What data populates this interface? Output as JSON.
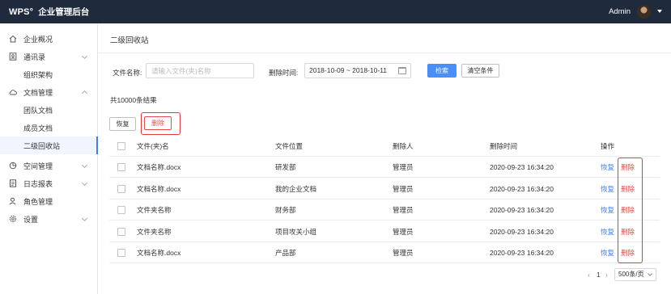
{
  "header": {
    "logo": "WPS°",
    "title": "企业管理后台",
    "user": "Admin"
  },
  "sidebar": {
    "items": [
      {
        "label": "企业概况",
        "icon": "home-icon"
      },
      {
        "label": "通讯录",
        "icon": "contacts-icon",
        "expandable": true
      },
      {
        "label": "组织架构",
        "sub": true
      },
      {
        "label": "文档管理",
        "icon": "cloud-icon",
        "expandable": true
      },
      {
        "label": "团队文档",
        "sub": true
      },
      {
        "label": "成员文档",
        "sub": true
      },
      {
        "label": "二级回收站",
        "sub": true,
        "active": true
      },
      {
        "label": "空间管理",
        "icon": "pie-chart-icon",
        "expandable": true
      },
      {
        "label": "日志报表",
        "icon": "report-icon",
        "expandable": true
      },
      {
        "label": "角色管理",
        "icon": "user-role-icon"
      },
      {
        "label": "设置",
        "icon": "gear-icon",
        "expandable": true
      }
    ]
  },
  "main": {
    "title": "二级回收站",
    "filter": {
      "name_label": "文件名称:",
      "name_placeholder": "请输入文件(夹)名称",
      "time_label": "删除时间:",
      "date_range": "2018-10-09 ~ 2018-10-11",
      "search_label": "检索",
      "clear_label": "清空条件"
    },
    "result_count": "共10000条结果",
    "actions": {
      "restore": "恢复",
      "delete": "删除"
    },
    "table": {
      "headers": [
        "文件(夹)名",
        "文件位置",
        "删除人",
        "删除时间",
        "操作"
      ],
      "rows": [
        {
          "name": "文档名称.docx",
          "location": "研发部",
          "deleter": "管理员",
          "time": "2020-09-23 16:34:20",
          "restore": "恢复",
          "delete": "删除"
        },
        {
          "name": "文档名称.docx",
          "location": "我的企业文档",
          "deleter": "管理员",
          "time": "2020-09-23 16:34:20",
          "restore": "恢复",
          "delete": "删除"
        },
        {
          "name": "文件夹名称",
          "location": "财务部",
          "deleter": "管理员",
          "time": "2020-09-23 16:34:20",
          "restore": "恢复",
          "delete": "删除"
        },
        {
          "name": "文件夹名称",
          "location": "项目攻关小组",
          "deleter": "管理员",
          "time": "2020-09-23 16:34:20",
          "restore": "恢复",
          "delete": "删除"
        },
        {
          "name": "文档名称.docx",
          "location": "产品部",
          "deleter": "管理员",
          "time": "2020-09-23 16:34:20",
          "restore": "恢复",
          "delete": "删除"
        }
      ]
    },
    "pagination": {
      "prev": "‹",
      "current": "1",
      "next": "›",
      "page_size": "500条/页"
    }
  },
  "colors": {
    "topbar": "#1f2a3d",
    "primary": "#4a8ef8",
    "danger": "#e54b4b",
    "highlight": "#e03a3a"
  }
}
